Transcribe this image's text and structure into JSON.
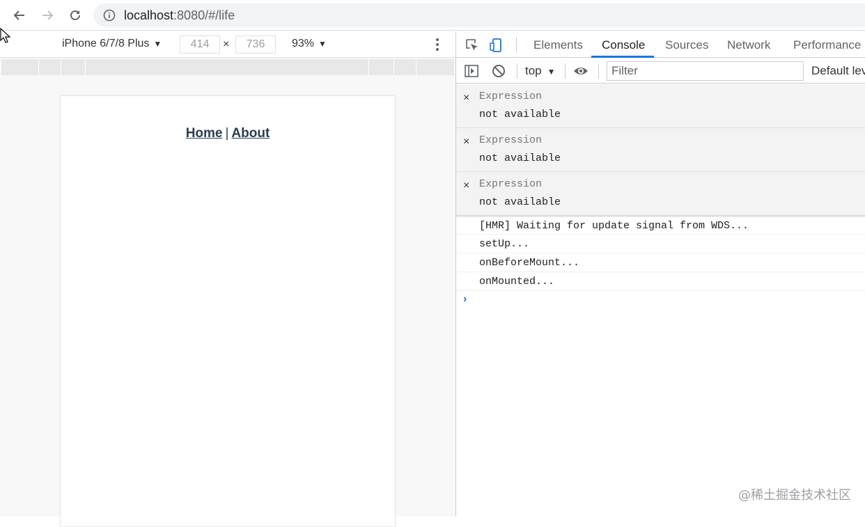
{
  "browser": {
    "url_host": "localhost",
    "url_path": ":8080/#/life",
    "back_icon": "arrow-left-icon",
    "forward_icon": "arrow-right-icon",
    "reload_icon": "reload-icon",
    "info_icon": "info-circle-icon"
  },
  "device_toolbar": {
    "device": "iPhone 6/7/8 Plus",
    "caret": "▼",
    "width": "414",
    "height": "736",
    "times": "×",
    "zoom": "93%"
  },
  "app": {
    "nav_home": "Home",
    "nav_sep": "|",
    "nav_about": "About"
  },
  "devtools": {
    "tabs": [
      "Elements",
      "Console",
      "Sources",
      "Network",
      "Performance"
    ],
    "active_tab": "Console",
    "context": "top",
    "filter_placeholder": "Filter",
    "levels": "Default lev",
    "expressions": [
      {
        "close": "×",
        "name": "Expression",
        "value": "not available"
      },
      {
        "close": "×",
        "name": "Expression",
        "value": "not available"
      },
      {
        "close": "×",
        "name": "Expression",
        "value": "not available"
      }
    ],
    "logs": [
      "[HMR] Waiting for update signal from WDS...",
      "setUp...",
      "onBeforeMount...",
      "onMounted..."
    ],
    "prompt": "›",
    "accent_color": "#1a73e8"
  },
  "watermark": "@稀土掘金技术社区"
}
